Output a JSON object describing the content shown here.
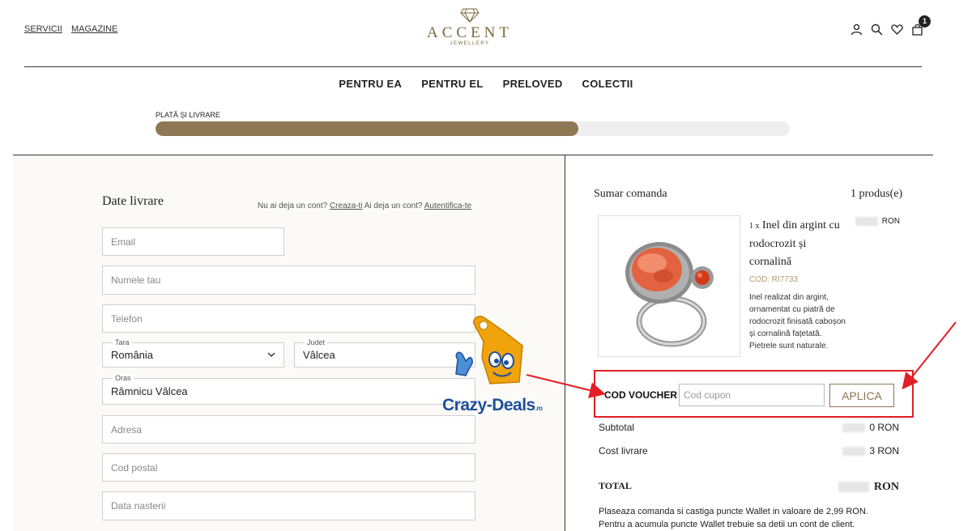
{
  "header": {
    "top_links": [
      "SERVICII",
      "MAGAZINE"
    ],
    "logo": {
      "brand": "ACCENT",
      "sub": "JEWELLERY"
    },
    "cart_count": "1"
  },
  "main_nav": [
    "PENTRU EA",
    "PENTRU EL",
    "PRELOVED",
    "COLECTII"
  ],
  "progress": {
    "label": "PLATĂ ȘI LIVRARE",
    "fraction": 0.667
  },
  "form": {
    "title": "Date livrare",
    "account_note": "Nu ai deja un cont?",
    "create_link": "Creaza-ti",
    "login_note": "Ai deja un cont?",
    "login_link": "Autentifica-te",
    "email_placeholder": "Email",
    "name_placeholder": "Numele tau",
    "phone_placeholder": "Telefon",
    "country_label": "Tara",
    "country_value": "România",
    "county_label": "Judet",
    "county_value": "Vâlcea",
    "city_label": "Oras",
    "city_value": "Râmnicu Vâlcea",
    "address_placeholder": "Adresa",
    "postal_placeholder": "Cod postal",
    "birthdate_placeholder": "Data nasterii"
  },
  "summary": {
    "title": "Sumar comanda",
    "count": "1 produs(e)",
    "product": {
      "qty": "1 x",
      "name": "Inel din argint cu rodocrozit și cornalină",
      "currency": "RON",
      "code": "COD: RI7733",
      "description": "Inel realizat din argint, ornamentat cu piatră de rodocrozit finisată caboșon și cornalină fațetată. Pietrele sunt naturale."
    },
    "voucher": {
      "label": "COD VOUCHER",
      "placeholder": "Cod cupon",
      "button": "APLICA"
    },
    "subtotal_label": "Subtotal",
    "subtotal_suffix": "0 RON",
    "shipping_label": "Cost livrare",
    "shipping_suffix": "3 RON",
    "total_label": "TOTAL",
    "total_suffix": "RON",
    "wallet_note": "Plaseaza comanda si castiga puncte Wallet in valoare de 2,99 RON. Pentru a acumula puncte Wallet trebuie sa detii un cont de client."
  },
  "watermark": {
    "text": "Crazy-Deals",
    "suffix": ".ro"
  },
  "colors": {
    "accent": "#8e7755",
    "highlight": "#e31e24",
    "watermark_blue": "#1d4f9c",
    "watermark_orange": "#f0a30a"
  }
}
